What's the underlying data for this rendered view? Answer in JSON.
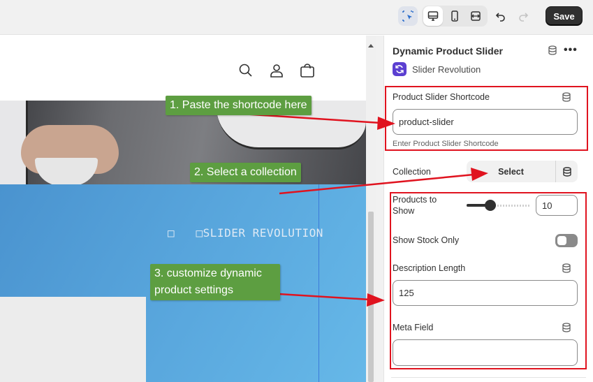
{
  "toolbar": {
    "icons": [
      "cursor-select-icon",
      "desktop-icon",
      "mobile-icon",
      "fullwidth-icon",
      "undo-icon",
      "redo-icon"
    ],
    "save_label": "Save"
  },
  "preview": {
    "header_icons": [
      "search-icon",
      "account-icon",
      "cart-icon"
    ],
    "slider_placeholder_text": "□   □SLIDER REVOLUTION"
  },
  "panel": {
    "title": "Dynamic Product Slider",
    "app_name": "Slider Revolution",
    "fields": {
      "shortcode": {
        "label": "Product Slider Shortcode",
        "value": "product-slider",
        "hint": "Enter Product Slider Shortcode"
      },
      "collection": {
        "label": "Collection",
        "button_label": "Select"
      },
      "products_to_show": {
        "label_line1": "Products to",
        "label_line2": "Show",
        "value": "10",
        "slider_fraction": 0.33
      },
      "show_stock_only": {
        "label": "Show Stock Only",
        "enabled": false
      },
      "description_length": {
        "label": "Description Length",
        "value": "125"
      },
      "meta_field": {
        "label": "Meta Field",
        "value": ""
      }
    }
  },
  "callouts": {
    "step1": "1. Paste the shortcode here",
    "step2": "2. Select a collection",
    "step3_line1": "3. customize dynamic",
    "step3_line2": "product settings"
  },
  "colors": {
    "highlight": "#e0131f",
    "callout_bg": "#5d9e41",
    "save_bg": "#303030",
    "app_icon": "#5b3fd1",
    "slider_bg": "#5aa8de"
  }
}
